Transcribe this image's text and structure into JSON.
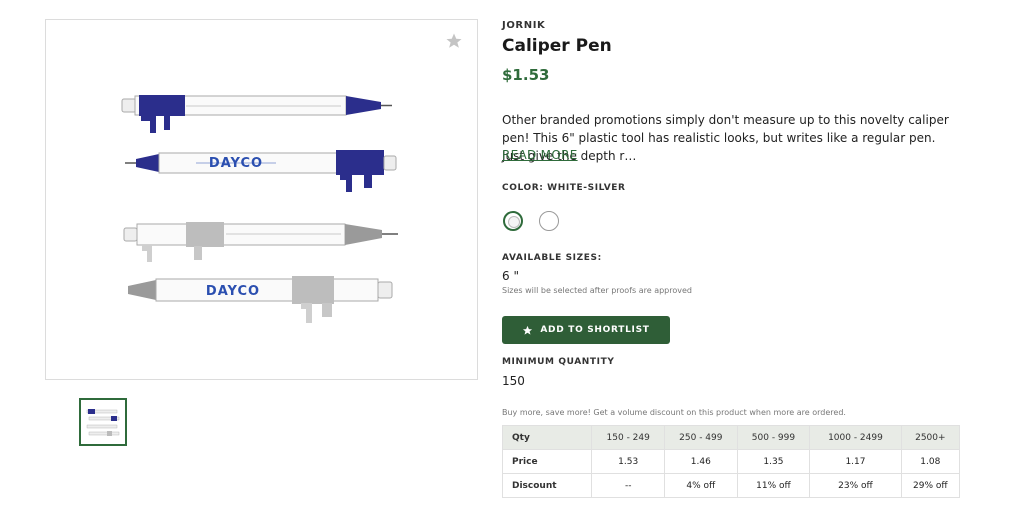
{
  "product": {
    "brand": "JORNIK",
    "title": "Caliper Pen",
    "price": "$1.53",
    "description": "Other branded promotions simply don't measure up to this novelty caliper pen! This 6\" plastic tool has realistic looks, but writes like a regular pen. Just give the depth r…",
    "read_more": "READ MORE",
    "pen_imprint": "DAYCO"
  },
  "color": {
    "label": "COLOR: WHITE-SILVER",
    "options": [
      "White-Silver",
      "White"
    ]
  },
  "sizes": {
    "label": "AVAILABLE SIZES:",
    "value": "6 \"",
    "note": "Sizes will be selected after proofs are approved"
  },
  "actions": {
    "add_to_shortlist": "ADD TO SHORTLIST"
  },
  "minimum": {
    "label": "MINIMUM QUANTITY",
    "value": "150"
  },
  "bulk": {
    "note": "Buy more, save more! Get a volume discount on this product when more are ordered.",
    "headers": [
      "Qty",
      "150 - 249",
      "250 - 499",
      "500 - 999",
      "1000 - 2499",
      "2500+"
    ],
    "price_row": [
      "Price",
      "1.53",
      "1.46",
      "1.35",
      "1.17",
      "1.08"
    ],
    "discount_row": [
      "Discount",
      "--",
      "4% off",
      "11% off",
      "23% off",
      "29% off"
    ]
  },
  "colors": {
    "accent": "#2f6b3b",
    "button": "#2f5e37",
    "pen_blue": "#2b2e8c",
    "table_header": "#e8ebe6"
  }
}
